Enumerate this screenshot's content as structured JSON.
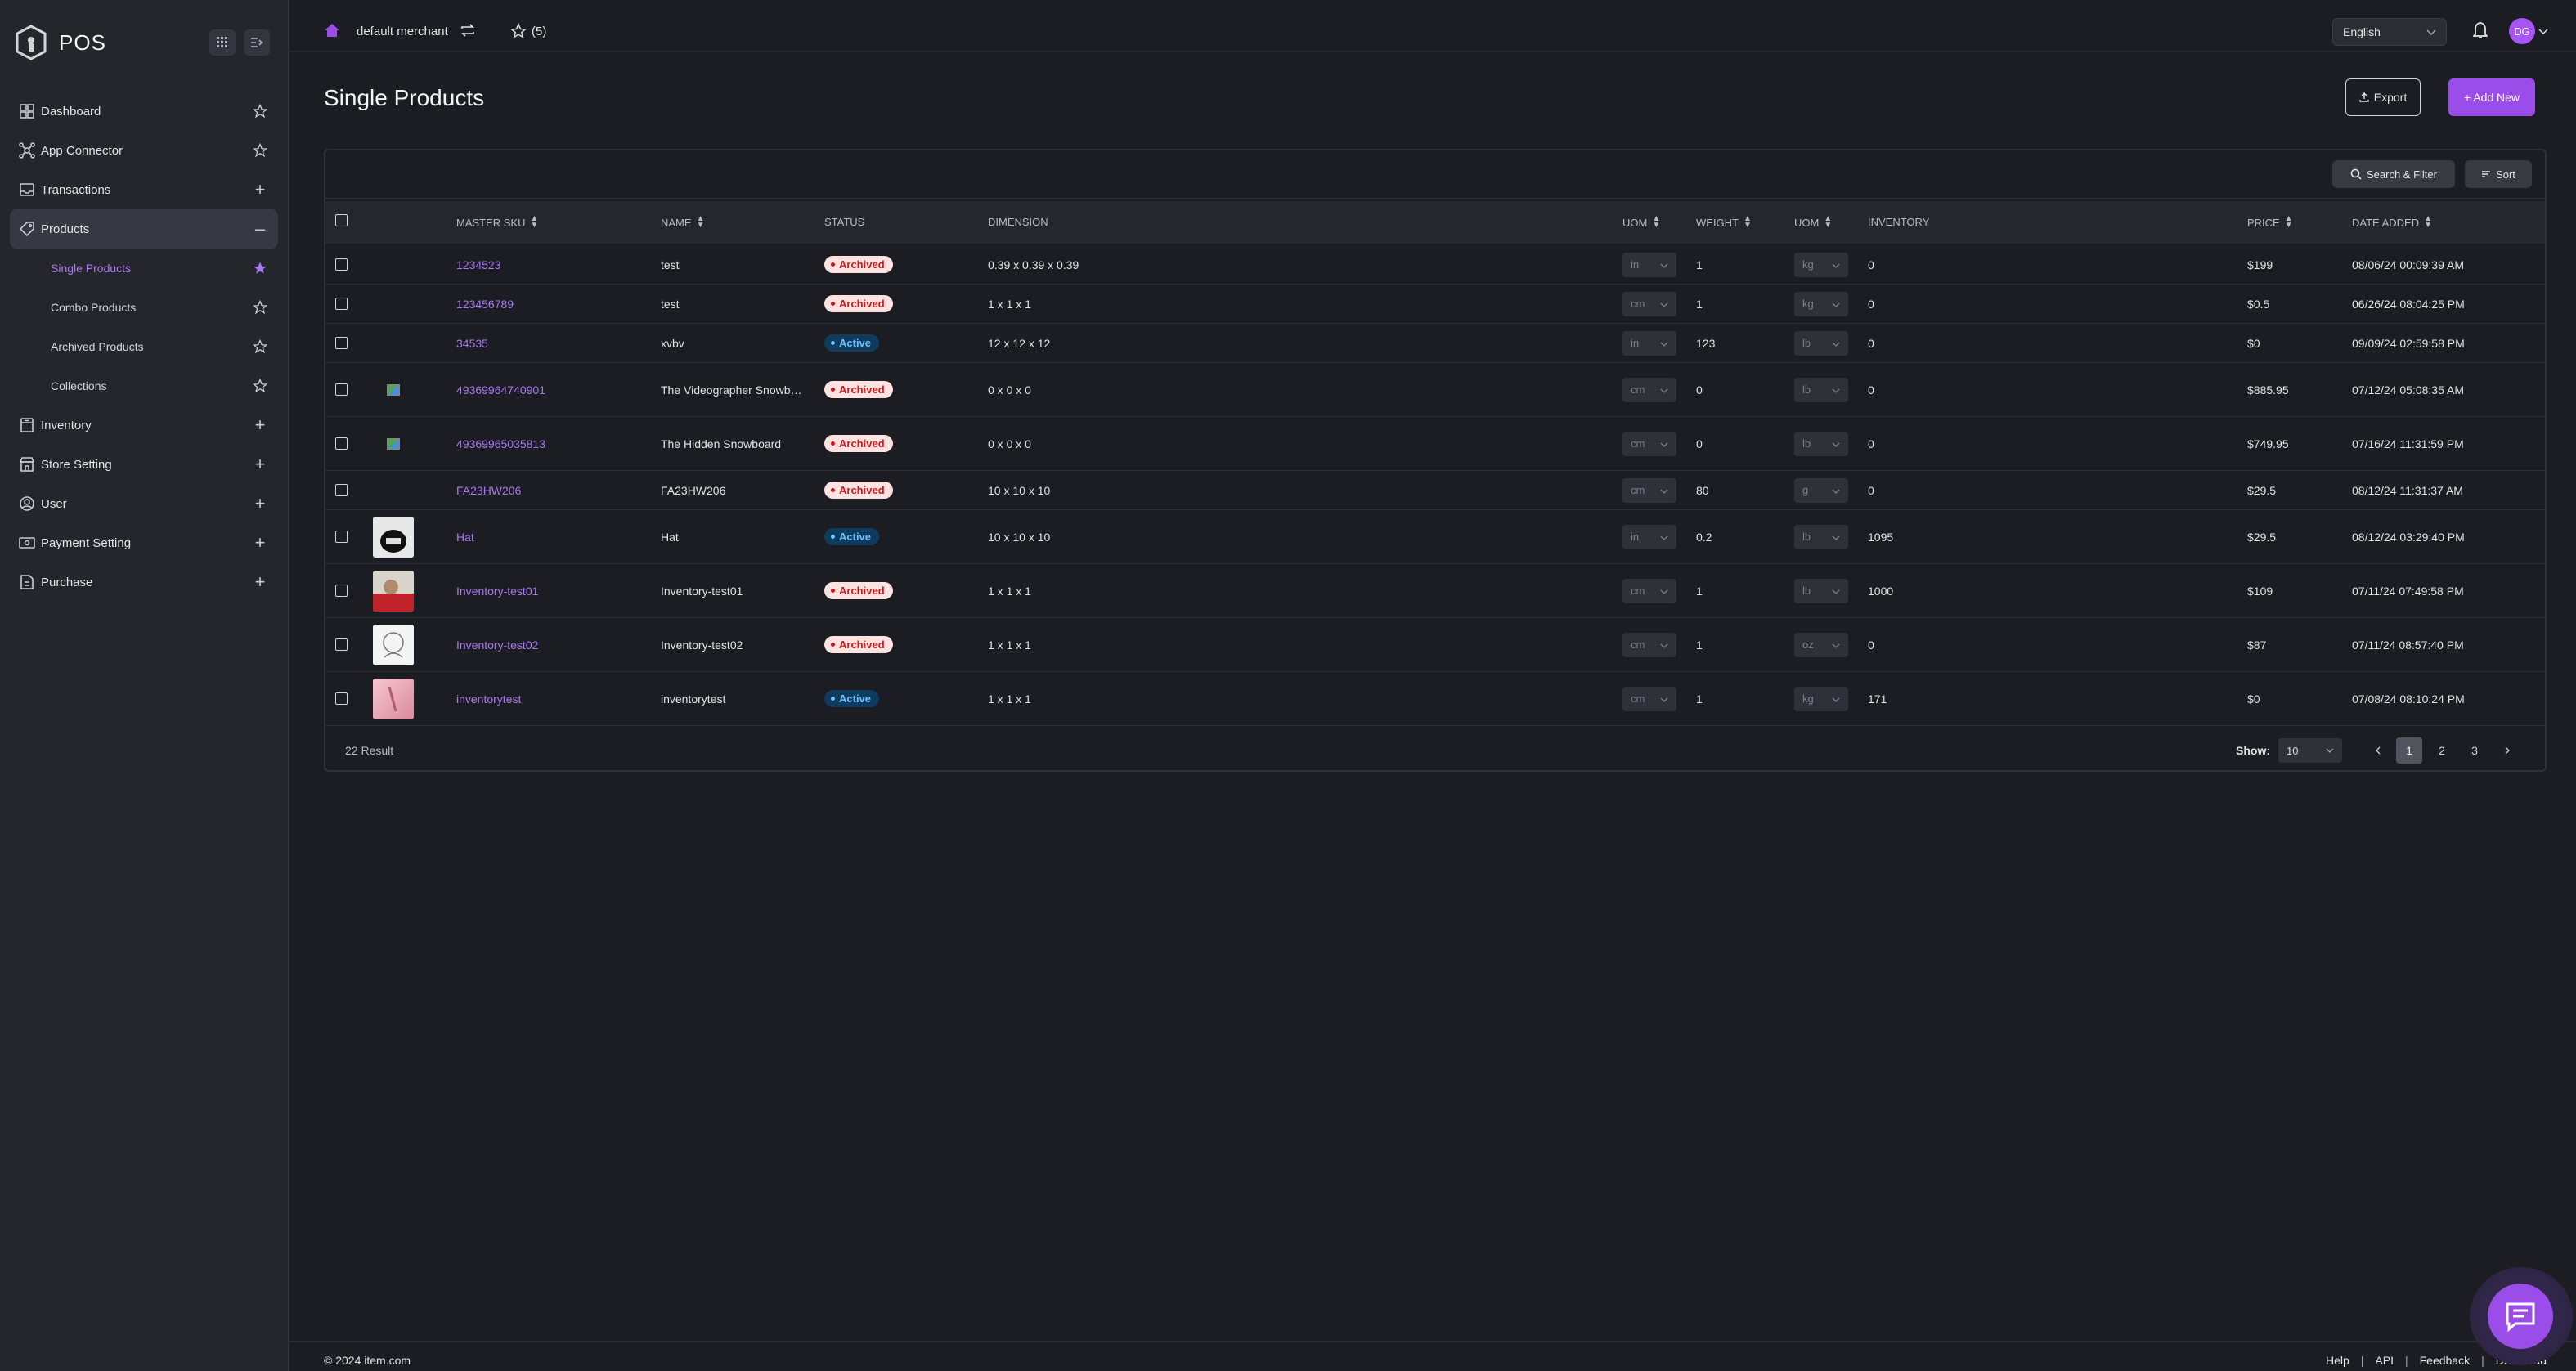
{
  "app": {
    "brand": "POS"
  },
  "topbar": {
    "merchant": "default merchant",
    "favorites_count": "(5)",
    "language": "English",
    "avatar_initials": "DG"
  },
  "sidebar": {
    "items": [
      {
        "label": "Dashboard",
        "icon": "dashboard-icon",
        "action": "star"
      },
      {
        "label": "App Connector",
        "icon": "app-connector-icon",
        "action": "star"
      },
      {
        "label": "Transactions",
        "icon": "transactions-icon",
        "action": "plus"
      },
      {
        "label": "Products",
        "icon": "tag-icon",
        "action": "minus"
      },
      {
        "label": "Inventory",
        "icon": "inventory-icon",
        "action": "plus"
      },
      {
        "label": "Store Setting",
        "icon": "store-icon",
        "action": "plus"
      },
      {
        "label": "User",
        "icon": "user-icon",
        "action": "plus"
      },
      {
        "label": "Payment Setting",
        "icon": "payment-icon",
        "action": "plus"
      },
      {
        "label": "Purchase",
        "icon": "purchase-icon",
        "action": "plus"
      }
    ],
    "products_sub": [
      {
        "label": "Single Products",
        "active": true
      },
      {
        "label": "Combo Products"
      },
      {
        "label": "Archived Products"
      },
      {
        "label": "Collections"
      }
    ]
  },
  "main": {
    "title": "Single Products",
    "export_label": "Export",
    "add_label": "+ Add New",
    "search_filter_label": "Search & Filter",
    "sort_label": "Sort"
  },
  "table": {
    "headers": {
      "master_sku": "MASTER SKU",
      "name": "NAME",
      "status": "STATUS",
      "dimension": "DIMENSION",
      "uom1": "UOM",
      "weight": "WEIGHT",
      "uom2": "UOM",
      "inventory": "INVENTORY",
      "price": "PRICE",
      "date_added": "DATE ADDED"
    },
    "rows": [
      {
        "sku": "1234523",
        "name": "test",
        "status": "Archived",
        "dimension": "0.39 x 0.39 x 0.39",
        "uom1": "in",
        "weight": "1",
        "uom2": "kg",
        "inventory": "0",
        "price": "$199",
        "date": "08/06/24 00:09:39 AM",
        "image": "none"
      },
      {
        "sku": "123456789",
        "name": "test",
        "status": "Archived",
        "dimension": "1 x 1 x 1",
        "uom1": "cm",
        "weight": "1",
        "uom2": "kg",
        "inventory": "0",
        "price": "$0.5",
        "date": "06/26/24 08:04:25 PM",
        "image": "none"
      },
      {
        "sku": "34535",
        "name": "xvbv",
        "status": "Active",
        "dimension": "12 x 12 x 12",
        "uom1": "in",
        "weight": "123",
        "uom2": "lb",
        "inventory": "0",
        "price": "$0",
        "date": "09/09/24 02:59:58 PM",
        "image": "none"
      },
      {
        "sku": "49369964740901",
        "name": "The Videographer Snowb…",
        "status": "Archived",
        "dimension": "0 x 0 x 0",
        "uom1": "cm",
        "weight": "0",
        "uom2": "lb",
        "inventory": "0",
        "price": "$885.95",
        "date": "07/12/24 05:08:35 AM",
        "image": "broken"
      },
      {
        "sku": "49369965035813",
        "name": "The Hidden Snowboard",
        "status": "Archived",
        "dimension": "0 x 0 x 0",
        "uom1": "cm",
        "weight": "0",
        "uom2": "lb",
        "inventory": "0",
        "price": "$749.95",
        "date": "07/16/24 11:31:59 PM",
        "image": "broken"
      },
      {
        "sku": "FA23HW206",
        "name": "FA23HW206",
        "status": "Archived",
        "dimension": "10 x 10 x 10",
        "uom1": "cm",
        "weight": "80",
        "uom2": "g",
        "inventory": "0",
        "price": "$29.5",
        "date": "08/12/24 11:31:37 AM",
        "image": "none"
      },
      {
        "sku": "Hat",
        "name": "Hat",
        "status": "Active",
        "dimension": "10 x 10 x 10",
        "uom1": "in",
        "weight": "0.2",
        "uom2": "lb",
        "inventory": "1095",
        "price": "$29.5",
        "date": "08/12/24 03:29:40 PM",
        "image": "hat"
      },
      {
        "sku": "Inventory-test01",
        "name": "Inventory-test01",
        "status": "Archived",
        "dimension": "1 x 1 x 1",
        "uom1": "cm",
        "weight": "1",
        "uom2": "lb",
        "inventory": "1000",
        "price": "$109",
        "date": "07/11/24 07:49:58 PM",
        "image": "red"
      },
      {
        "sku": "Inventory-test02",
        "name": "Inventory-test02",
        "status": "Archived",
        "dimension": "1 x 1 x 1",
        "uom1": "cm",
        "weight": "1",
        "uom2": "oz",
        "inventory": "0",
        "price": "$87",
        "date": "07/11/24 08:57:40 PM",
        "image": "sketch"
      },
      {
        "sku": "inventorytest",
        "name": "inventorytest",
        "status": "Active",
        "dimension": "1 x 1 x 1",
        "uom1": "cm",
        "weight": "1",
        "uom2": "kg",
        "inventory": "171",
        "price": "$0",
        "date": "07/08/24 08:10:24 PM",
        "image": "pink"
      }
    ],
    "result_text": "22 Result",
    "show_label": "Show:",
    "page_size": "10",
    "pages": [
      "1",
      "2",
      "3"
    ],
    "current_page": "1"
  },
  "footer": {
    "copyright": "© 2024 item.com",
    "links": [
      "Help",
      "API",
      "Feedback",
      "Download"
    ]
  },
  "colors": {
    "accent": "#9b4dea",
    "link": "#a779f0",
    "archived_bg": "#fde2e2",
    "archived_text": "#c81e1e",
    "active_bg": "#0f3b5e",
    "active_text": "#6cc0ff"
  }
}
